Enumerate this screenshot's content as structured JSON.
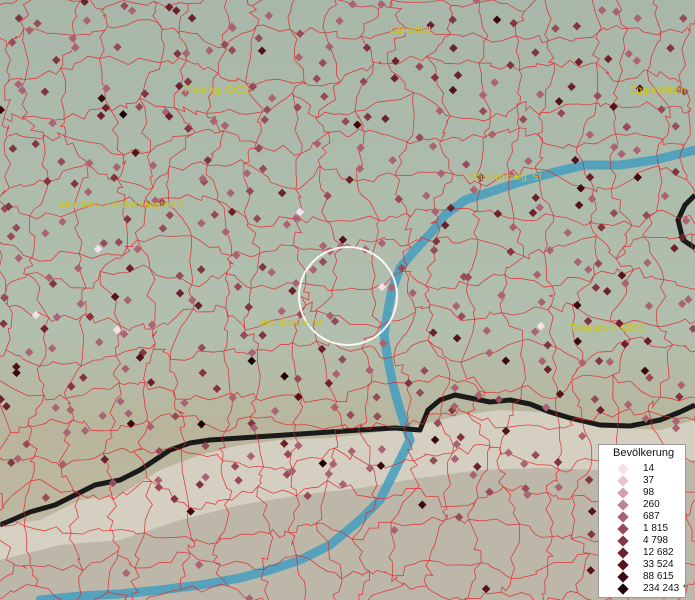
{
  "cities": [
    {
      "id": "landshut",
      "label": "Landshut"
    },
    {
      "id": "freising",
      "label": "Freising, GKSt"
    },
    {
      "id": "eggenfelden",
      "label": "Eggenfelden"
    },
    {
      "id": "waldkraiburg",
      "label": "Waldkraiburg, St"
    },
    {
      "id": "muenchen",
      "label": "München, Landeshauptstadt"
    },
    {
      "id": "bruckmuehl",
      "label": "Bruckmühl, M"
    },
    {
      "id": "traunstein",
      "label": "Traunstein, GKSt"
    }
  ],
  "legend": {
    "title": "Bevölkerung",
    "entries": [
      {
        "label": "14",
        "color": "#f6e0ea"
      },
      {
        "label": "37",
        "color": "#e6c2cd"
      },
      {
        "label": "98",
        "color": "#d2a0ad"
      },
      {
        "label": "260",
        "color": "#bf8290"
      },
      {
        "label": "687",
        "color": "#a96372"
      },
      {
        "label": "1 815",
        "color": "#964b58"
      },
      {
        "label": "4 798",
        "color": "#813640"
      },
      {
        "label": "12 682",
        "color": "#6b222c"
      },
      {
        "label": "33 524",
        "color": "#54141b"
      },
      {
        "label": "88 615",
        "color": "#3d0a0e"
      },
      {
        "label": "234 243 ⁺",
        "color": "#1c0204"
      }
    ]
  },
  "colors": {
    "boundary": "#e0262a",
    "river": "#4a9fbe",
    "border": "#1a1a1a",
    "label": "#d6cf1a",
    "lowland": "#a9b8ac",
    "highlight_circle": "#ffffff"
  }
}
